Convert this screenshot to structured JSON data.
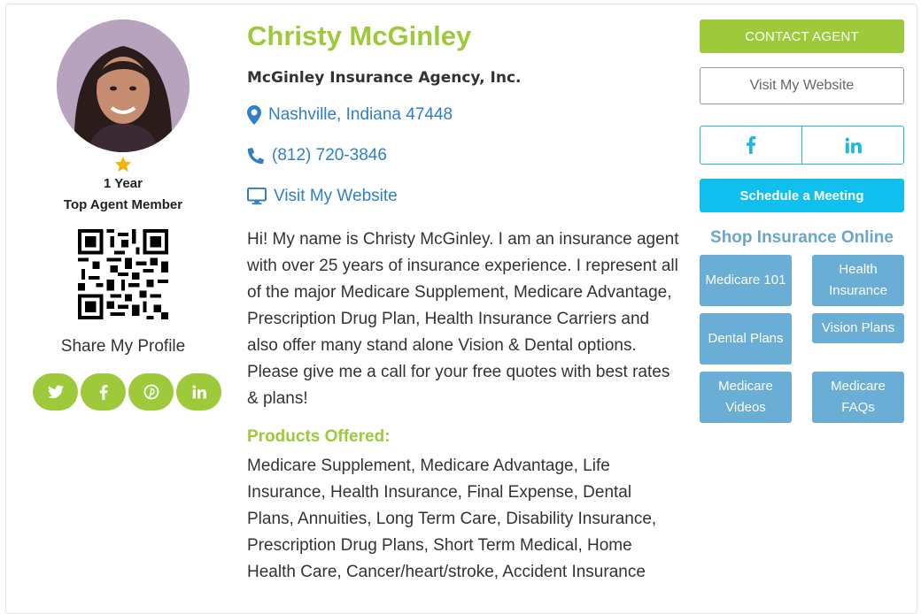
{
  "agent": {
    "name": "Christy McGinley",
    "agency": "McGinley Insurance Agency, Inc.",
    "location": "Nashville, Indiana 47448",
    "phone": "(812) 720-3846",
    "website_link": "Visit My Website",
    "membership_years": "1 Year",
    "membership_label": "Top Agent Member",
    "bio": "Hi! My name is Christy McGinley. I am an insurance agent with over 25 years of insurance experience. I represent all of the major Medicare Supplement, Medicare Advantage, Prescription Drug Plan, Health Insurance Carriers and also offer many stand alone Vision & Dental options. Please give me a call for your free quotes with best rates & plans!",
    "products_title": "Products Offered:",
    "products": "Medicare Supplement, Medicare Advantage, Life Insurance, Health Insurance, Final Expense, Dental Plans, Annuities, Long Term Care, Disability Insurance, Prescription Drug Plans, Short Term Medical, Home Health Care, Cancer/heart/stroke, Accident Insurance"
  },
  "share": {
    "label": "Share My Profile",
    "icons": [
      "twitter-icon",
      "facebook-icon",
      "pinterest-icon",
      "linkedin-icon"
    ]
  },
  "actions": {
    "contact": "CONTACT AGENT",
    "website": "Visit My Website",
    "schedule": "Schedule a Meeting"
  },
  "shop": {
    "title": "Shop Insurance Online",
    "items": [
      "Medicare 101",
      "Health Insurance",
      "Dental Plans",
      "Vision Plans",
      "Medicare Videos",
      "Medicare FAQs"
    ]
  },
  "colors": {
    "accent_green": "#9dc93a",
    "link_blue": "#2f7fc8",
    "cyan": "#0fc0ee",
    "shop_blue": "#6aaed6",
    "shop_title": "#6aa6cc"
  }
}
